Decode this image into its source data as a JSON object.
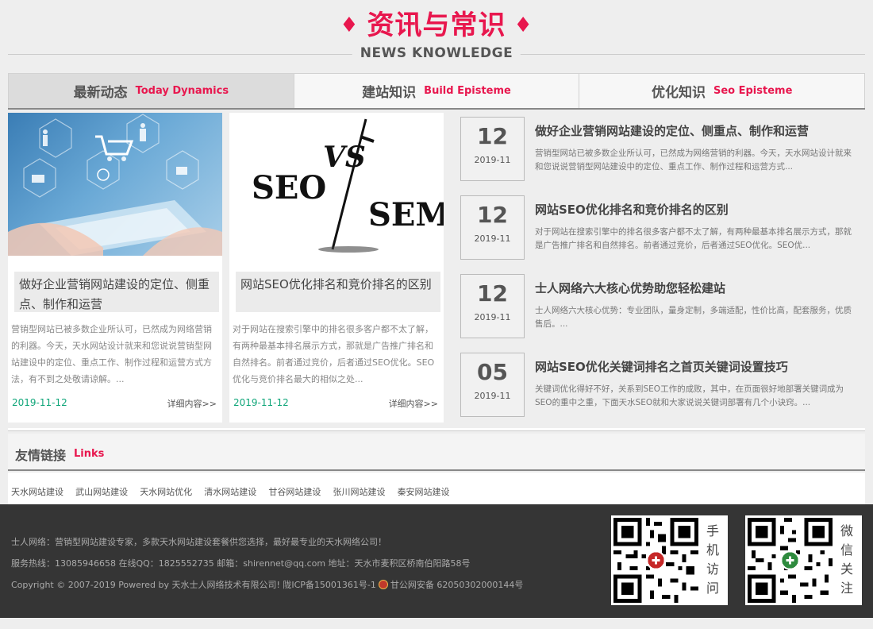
{
  "heading": {
    "title": "资讯与常识",
    "subtitle": "NEWS KNOWLEDGE",
    "accent_color": "#e8174e"
  },
  "tabs": [
    {
      "cn": "最新动态",
      "en": "Today Dynamics",
      "active": true
    },
    {
      "cn": "建站知识",
      "en": "Build Episteme",
      "active": false
    },
    {
      "cn": "优化知识",
      "en": "Seo Episteme",
      "active": false
    }
  ],
  "cards": [
    {
      "image_alt": "hand-holding-tablet-ecommerce-icons",
      "title": "做好企业营销网站建设的定位、侧重点、制作和运营",
      "desc": "营销型网站已被多数企业所认可，已然成为网络营销的利器。今天，天水网站设计就来和您说说营销型网站建设中的定位、重点工作、制作过程和运营方式方法，有不到之处敬请谅解。...",
      "date": "2019-11-12",
      "more": "详细内容>>"
    },
    {
      "image_text": {
        "left": "SEO",
        "mid": "VS",
        "right": "SEM"
      },
      "title": "网站SEO优化排名和竞价排名的区别",
      "desc": "对于网站在搜索引擎中的排名很多客户都不太了解，有两种最基本排名展示方式，那就是广告推广排名和自然排名。前者通过竞价，后者通过SEO优化。SEO优化与竞价排名最大的相似之处...",
      "date": "2019-11-12",
      "more": "详细内容>>"
    }
  ],
  "news": [
    {
      "day": "12",
      "ym": "2019-11",
      "title": "做好企业营销网站建设的定位、侧重点、制作和运营",
      "desc": "营销型网站已被多数企业所认可，已然成为网络营销的利器。今天，天水网站设计就来和您说说营销型网站建设中的定位、重点工作、制作过程和运营方式..."
    },
    {
      "day": "12",
      "ym": "2019-11",
      "title": "网站SEO优化排名和竞价排名的区别",
      "desc": "对于网站在搜索引擎中的排名很多客户都不太了解，有两种最基本排名展示方式，那就是广告推广排名和自然排名。前者通过竞价，后者通过SEO优化。SEO优..."
    },
    {
      "day": "12",
      "ym": "2019-11",
      "title": "士人网络六大核心优势助您轻松建站",
      "desc": "士人网络六大核心优势：专业团队，量身定制，多端适配，性价比高，配套服务，优质售后。..."
    },
    {
      "day": "05",
      "ym": "2019-11",
      "title": "网站SEO优化关键词排名之首页关键词设置技巧",
      "desc": "关键词优化得好不好，关系到SEO工作的成败，其中，在页面很好地部署关键词成为SEO的重中之重，下面天水SEO就和大家说说关键词部署有几个小诀窍。..."
    }
  ],
  "links": {
    "cn": "友情链接",
    "en": "Links",
    "items": [
      "天水网站建设",
      "武山网站建设",
      "天水网站优化",
      "清水网站建设",
      "甘谷网站建设",
      "张川网站建设",
      "秦安网站建设"
    ]
  },
  "footer": {
    "line1": "士人网络：营销型网站建设专家，多款天水网站建设套餐供您选择，最好最专业的天水网络公司！",
    "line2": "服务热线：13085946658 在线QQ：1825552735 邮箱：shirennet@qq.com 地址：天水市麦积区桥南伯阳路58号",
    "line3_a": "Copyright © 2007-2019 Powered by 天水士人网络技术有限公司! 陇ICP备15001361号-1",
    "line3_b": "甘公网安备 62050302000144号",
    "qr": [
      {
        "label": "手机访问",
        "icon": "red-badge"
      },
      {
        "label": "微信关注",
        "icon": "green-badge"
      }
    ]
  }
}
